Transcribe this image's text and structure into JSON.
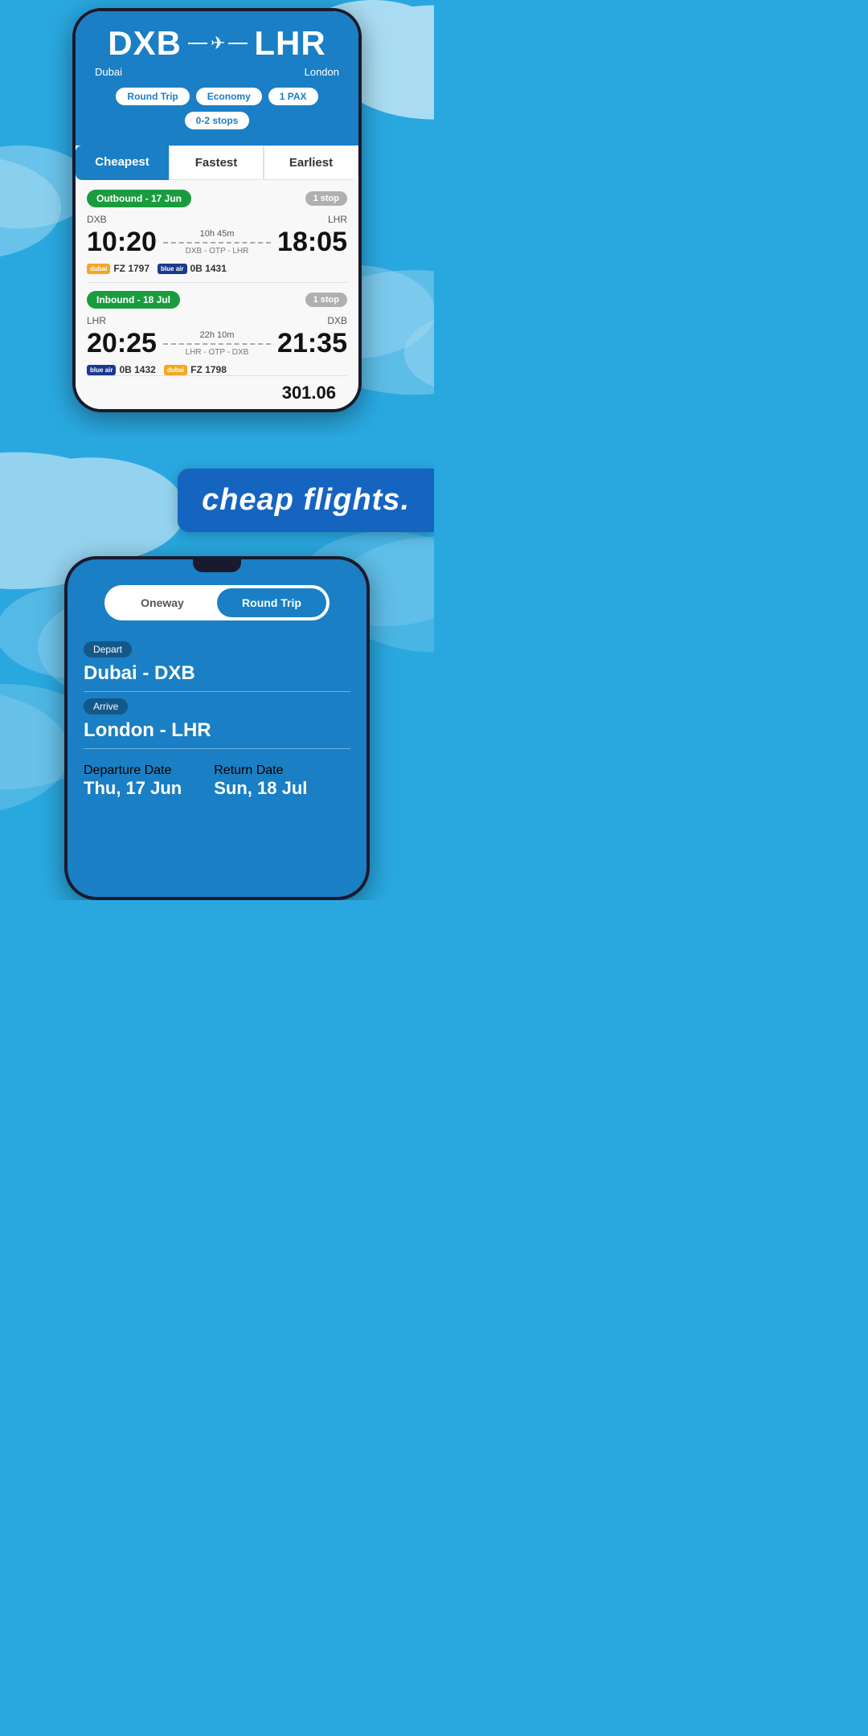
{
  "top_phone": {
    "origin_code": "DXB",
    "origin_city": "Dubai",
    "destination_code": "LHR",
    "destination_city": "London",
    "filters": {
      "trip_type": "Round Trip",
      "cabin": "Economy",
      "pax": "1 PAX",
      "stops": "0-2 stops"
    },
    "tabs": [
      {
        "label": "Cheapest",
        "active": true
      },
      {
        "label": "Fastest",
        "active": false
      },
      {
        "label": "Earliest",
        "active": false
      }
    ],
    "outbound": {
      "label": "Outbound - 17 Jun",
      "stop_label": "1 stop",
      "origin": "DXB",
      "destination": "LHR",
      "depart_time": "10:20",
      "arrive_time": "18:05",
      "duration": "10h 45m",
      "route": "DXB - OTP - LHR",
      "airlines": [
        {
          "logo": "dubai",
          "text": "FZ 1797"
        },
        {
          "logo": "blue",
          "text": "0B 1431"
        }
      ]
    },
    "inbound": {
      "label": "Inbound - 18 Jul",
      "stop_label": "1 stop",
      "origin": "LHR",
      "destination": "DXB",
      "depart_time": "20:25",
      "arrive_time": "21:35",
      "duration": "22h 10m",
      "route": "LHR - OTP - DXB",
      "airlines": [
        {
          "logo": "blue",
          "text": "0B 1432"
        },
        {
          "logo": "dubai",
          "text": "FZ 1798"
        }
      ]
    },
    "price_partial": "301.06"
  },
  "banner": {
    "text": "cheap flights."
  },
  "bottom_phone": {
    "trip_toggle": {
      "oneway": "Oneway",
      "round_trip": "Round Trip",
      "active": "round_trip"
    },
    "depart_label": "Depart",
    "depart_value": "Dubai - DXB",
    "arrive_label": "Arrive",
    "arrive_value": "London - LHR",
    "departure_date_label": "Departure Date",
    "departure_date_value": "Thu, 17 Jun",
    "return_date_label": "Return Date",
    "return_date_value": "Sun, 18 Jul"
  }
}
